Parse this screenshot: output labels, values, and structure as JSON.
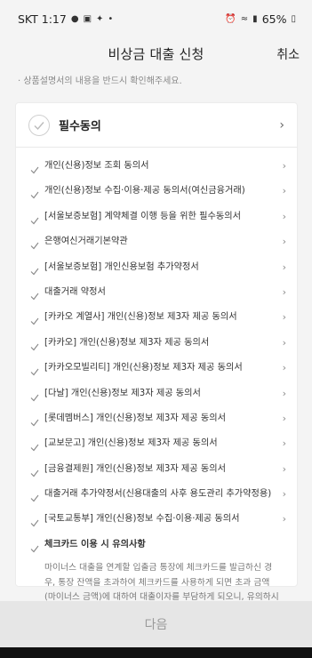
{
  "status": {
    "carrier_time": "SKT 1:17",
    "battery": "65%"
  },
  "header": {
    "title": "비상금 대출 신청",
    "cancel": "취소"
  },
  "notice": "· 상품설명서의 내용을 반드시 확인해주세요.",
  "agree_all": {
    "label": "필수동의"
  },
  "items": [
    "개인(신용)정보 조회 동의서",
    "개인(신용)정보 수집·이용·제공 동의서(여신금융거래)",
    "[서울보증보험] 계약체결 이행 등을 위한 필수동의서",
    "은행여신거래기본약관",
    "[서울보증보험] 개인신용보험 추가약정서",
    "대출거래 약정서",
    "[카카오 계열사] 개인(신용)정보 제3자 제공 동의서",
    "[카카오] 개인(신용)정보 제3자 제공 동의서",
    "[카카오모빌리티] 개인(신용)정보 제3자 제공 동의서",
    "[다날] 개인(신용)정보 제3자 제공 동의서",
    "[롯데멤버스] 개인(신용)정보 제3자 제공 동의서",
    "[교보문고] 개인(신용)정보 제3자 제공 동의서",
    "[금융결제원] 개인(신용)정보 제3자 제공 동의서",
    "대출거래 추가약정서(신용대출의 사후 용도관리 추가약정용)",
    "[국토교통부] 개인(신용)정보 수집·이용·제공 동의서"
  ],
  "check_card": {
    "title": "체크카드 이용 시 유의사항",
    "body": "마이너스 대출을 연계할 입출금 통장에 체크카드를 발급하신 경우, 통장 잔액을 초과하여 체크카드를 사용하게 되면 초과 금액(마이너스 금액)에 대하여 대출이자를 부담하게 되오니, 유의하시기 바랍니다."
  },
  "next_button": "다음"
}
